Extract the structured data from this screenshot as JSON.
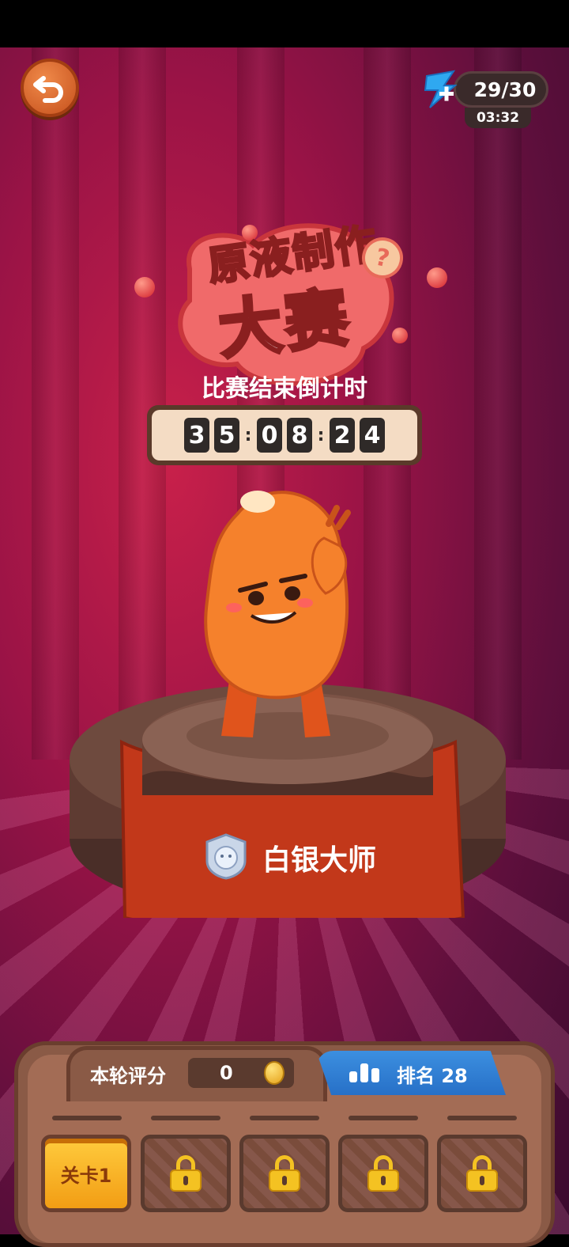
{
  "header": {
    "back_icon": "undo-arrow-icon",
    "energy": {
      "icon": "lightning-plus-icon",
      "value": "29/30",
      "timer": "03:32"
    }
  },
  "event": {
    "title_line1": "原液制作",
    "title_line2": "大赛",
    "help_icon": "question-icon",
    "countdown_label": "比赛结束倒计时",
    "countdown": {
      "d1": "3",
      "d2": "5",
      "d3": "0",
      "d4": "8",
      "d5": "2",
      "d6": "4"
    }
  },
  "player": {
    "rank_title": "白银大师",
    "rank_badge_icon": "silver-badge-icon"
  },
  "bottom": {
    "score_label": "本轮评分",
    "score_value": "0",
    "coin_icon": "coin-icon",
    "rank_label": "排名 28",
    "rank_icon": "bar-chart-icon",
    "levels": [
      {
        "label": "关卡1",
        "locked": false
      },
      {
        "label": "",
        "locked": true
      },
      {
        "label": "",
        "locked": true
      },
      {
        "label": "",
        "locked": true
      },
      {
        "label": "",
        "locked": true
      }
    ]
  },
  "colors": {
    "stage_bg": "#9a1346",
    "panel": "#a36c55",
    "rank_tab": "#2f7fd6",
    "level_active": "#f7b32a"
  }
}
